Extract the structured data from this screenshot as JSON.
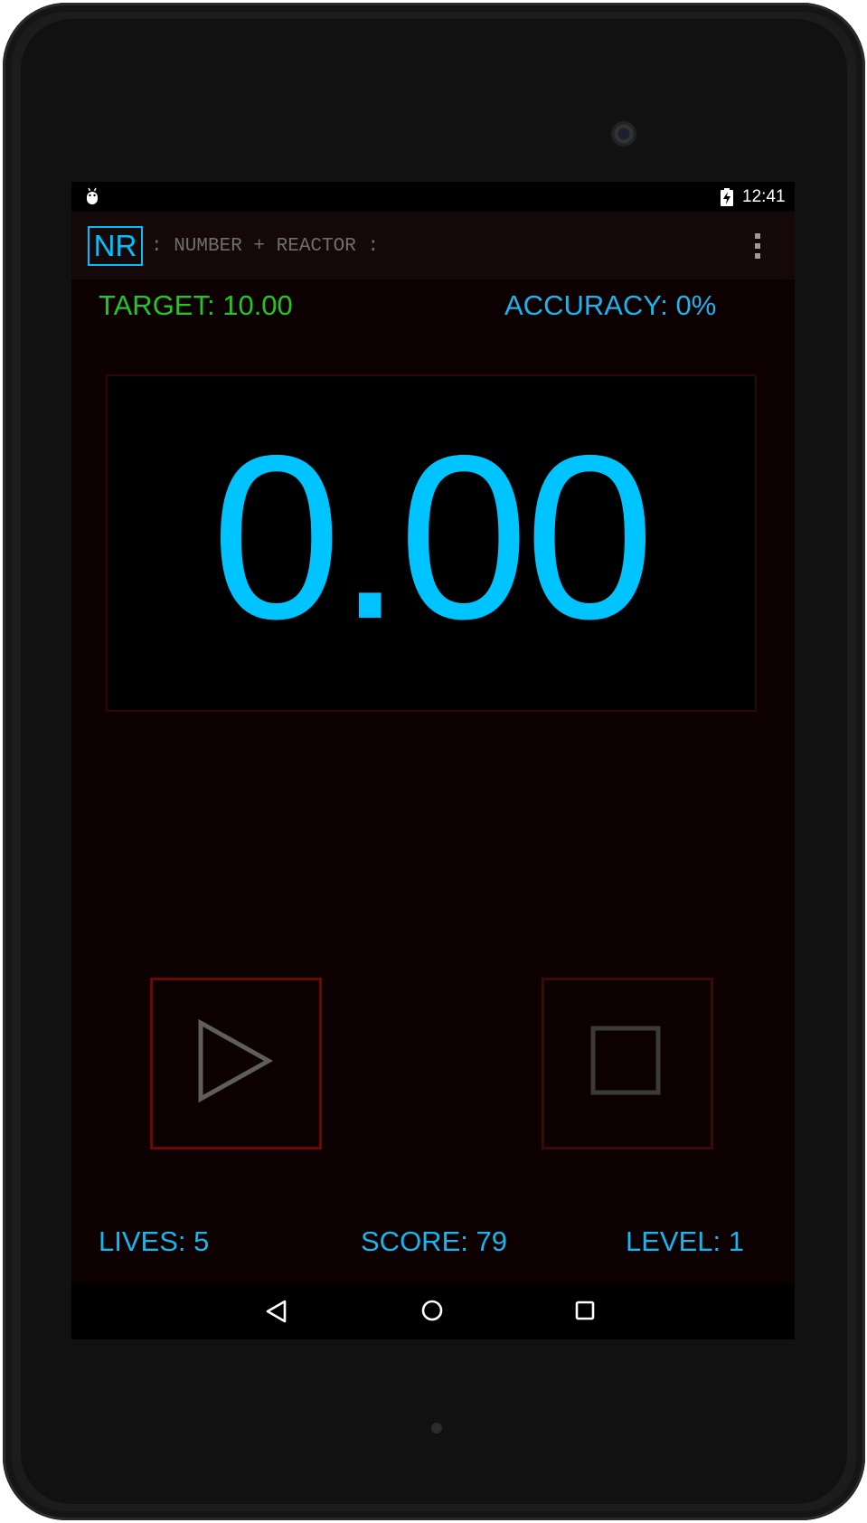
{
  "status_bar": {
    "left_icon": "android-debug-icon",
    "battery_icon": "battery-charging-icon",
    "time": "12:41"
  },
  "action_bar": {
    "logo": "NR",
    "title": ": NUMBER + REACTOR :",
    "overflow_icon": "more-vert-icon"
  },
  "game": {
    "target": "TARGET: 10.00",
    "accuracy": "ACCURACY: 0%",
    "display_value": "0.00",
    "play_icon": "play-icon",
    "stop_icon": "stop-icon",
    "lives": "LIVES: 5",
    "score": "SCORE: 79",
    "level": "LEVEL: 1"
  },
  "nav_bar": {
    "back_icon": "back-triangle-icon",
    "home_icon": "home-circle-icon",
    "recent_icon": "recent-apps-icon"
  },
  "colors": {
    "accent_blue": "#00c4ff",
    "target_green": "#22c722",
    "play_border": "#6a0808",
    "stop_border": "#3a0a0a",
    "background": "#0d0000"
  }
}
